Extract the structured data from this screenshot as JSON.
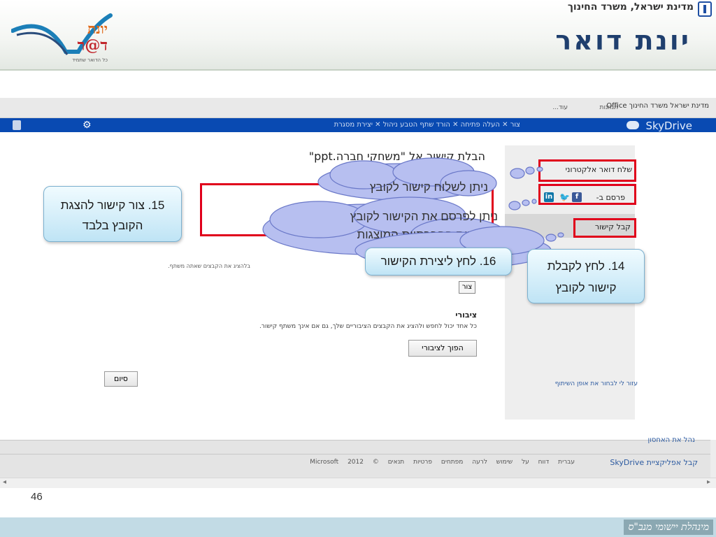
{
  "slide_header": {
    "ministry": "מדינת ישראל, משרד החינוך",
    "product_title": "יונת דואר",
    "logo_text_top": "יונת",
    "logo_text_main": "ד@ר",
    "logo_tagline": "כל הדואר שתמיד"
  },
  "ms_bar": {
    "ministry_small": "מדינת ישראל משרד החינוך",
    "office": "Office",
    "images": "תמונות",
    "more": "עוד..."
  },
  "sky_bar": {
    "brand": "SkyDrive",
    "commands": "צור ✕    העלה    פתיחה ✕    הורד    שתף    הטבע    ניהול ✕    יצירת מסגרת"
  },
  "dialog": {
    "title": "הבלת קישור אל \"משחקי חברה.ppt\"",
    "create_button": "צור",
    "shared_note": "בלהציג את הקבצים שאתה משתף.",
    "public_title": "ציבורי",
    "public_desc": "כל אחד יכול לחפש ולהציג את הקבצים הציבוריים שלך, גם אם אינך משתף קישור.",
    "make_public_button": "הפוך לציבורי",
    "done_button": "סיום"
  },
  "sidebar": {
    "email": "שלח דואר אלקטרוני",
    "post": "פרסם ב-",
    "get_link": "קבל קישור",
    "help": "עזור לי לבחור את אופן השיתוף"
  },
  "social_icons": {
    "facebook": "f",
    "twitter": "🐦",
    "linkedin": "in"
  },
  "footer": {
    "links": "עברית    דווח על שימוש לרעה    מפתחים    פרטיות    תנאים    © 2012 Microsoft",
    "app": "קבל אפליקציית SkyDrive",
    "cut_text": "נהל את האחסון"
  },
  "annotations": {
    "callout_15": [
      "15. צור קישור להצגת",
      "הקובץ בלבד"
    ],
    "callout_14": [
      "14. לחץ לקבלת",
      "קישור לקובץ"
    ],
    "callout_16": "16. לחץ ליצירת הקישור",
    "cloud_1": "ניתן לשלוח קישור לקובץ",
    "cloud_2": [
      "ניתן לפרסם את הקישור לקובץ",
      "ברשתות החברתיות המוצגות"
    ]
  },
  "slide_number": "46",
  "footer_strip": "מינהלת יישומי מנב\"ס",
  "colors": {
    "annotation_red": "#e0001b",
    "skydrive_blue": "#094ab2",
    "callout_blue": "#bfe4f5",
    "cloud_purple": "#b7bff0"
  }
}
